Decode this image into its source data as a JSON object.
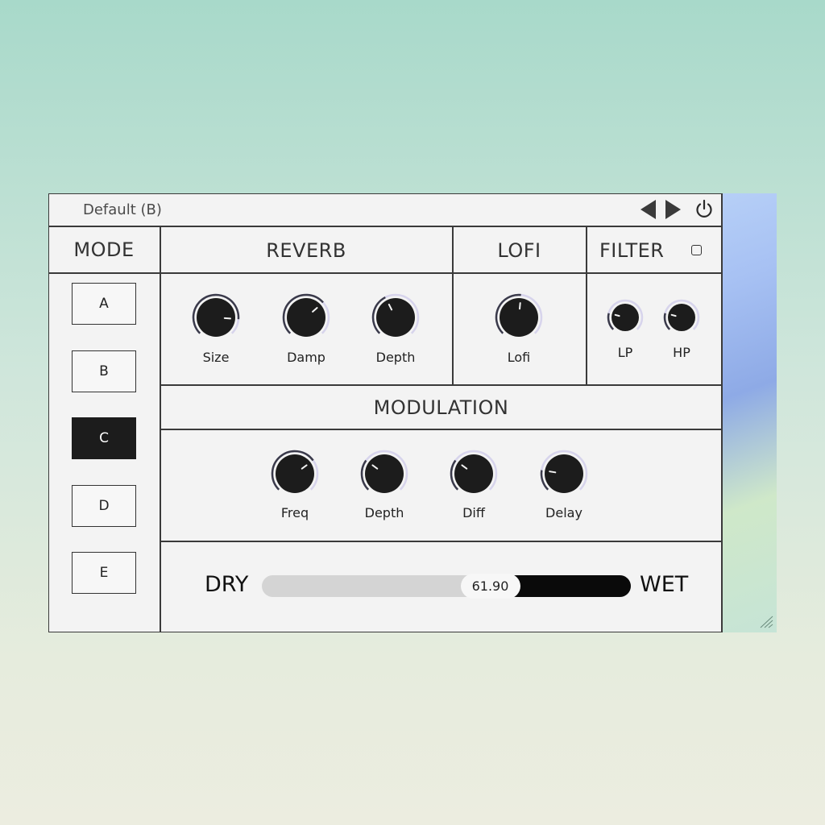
{
  "header": {
    "preset_name": "Default (B)"
  },
  "mode": {
    "title": "MODE",
    "buttons": [
      "A",
      "B",
      "C",
      "D",
      "E"
    ],
    "selected": "C"
  },
  "reverb": {
    "title": "REVERB",
    "knobs": [
      {
        "label": "Size",
        "value": 0.85
      },
      {
        "label": "Damp",
        "value": 0.68
      },
      {
        "label": "Depth",
        "value": 0.4
      }
    ]
  },
  "lofi": {
    "title": "LOFI",
    "knobs": [
      {
        "label": "Lofi",
        "value": 0.52
      }
    ]
  },
  "filter": {
    "title": "FILTER",
    "knobs": [
      {
        "label": "LP",
        "value": 0.22
      },
      {
        "label": "HP",
        "value": 0.22
      }
    ]
  },
  "modulation": {
    "title": "MODULATION",
    "knobs": [
      {
        "label": "Freq",
        "value": 0.7
      },
      {
        "label": "Depth",
        "value": 0.3
      },
      {
        "label": "Diff",
        "value": 0.3
      },
      {
        "label": "Delay",
        "value": 0.2
      }
    ]
  },
  "mix": {
    "dry_label": "DRY",
    "wet_label": "WET",
    "value_text": "61.90",
    "value_fraction": 0.619
  },
  "colors": {
    "knob_body": "#1c1c1c",
    "knob_ring": "#3a3a4a",
    "knob_track": "#d7d4ec",
    "slider_fill": "#0a0a0a"
  },
  "icons": [
    "arrow-left-icon",
    "arrow-right-icon",
    "power-icon",
    "resize-grip-icon"
  ]
}
